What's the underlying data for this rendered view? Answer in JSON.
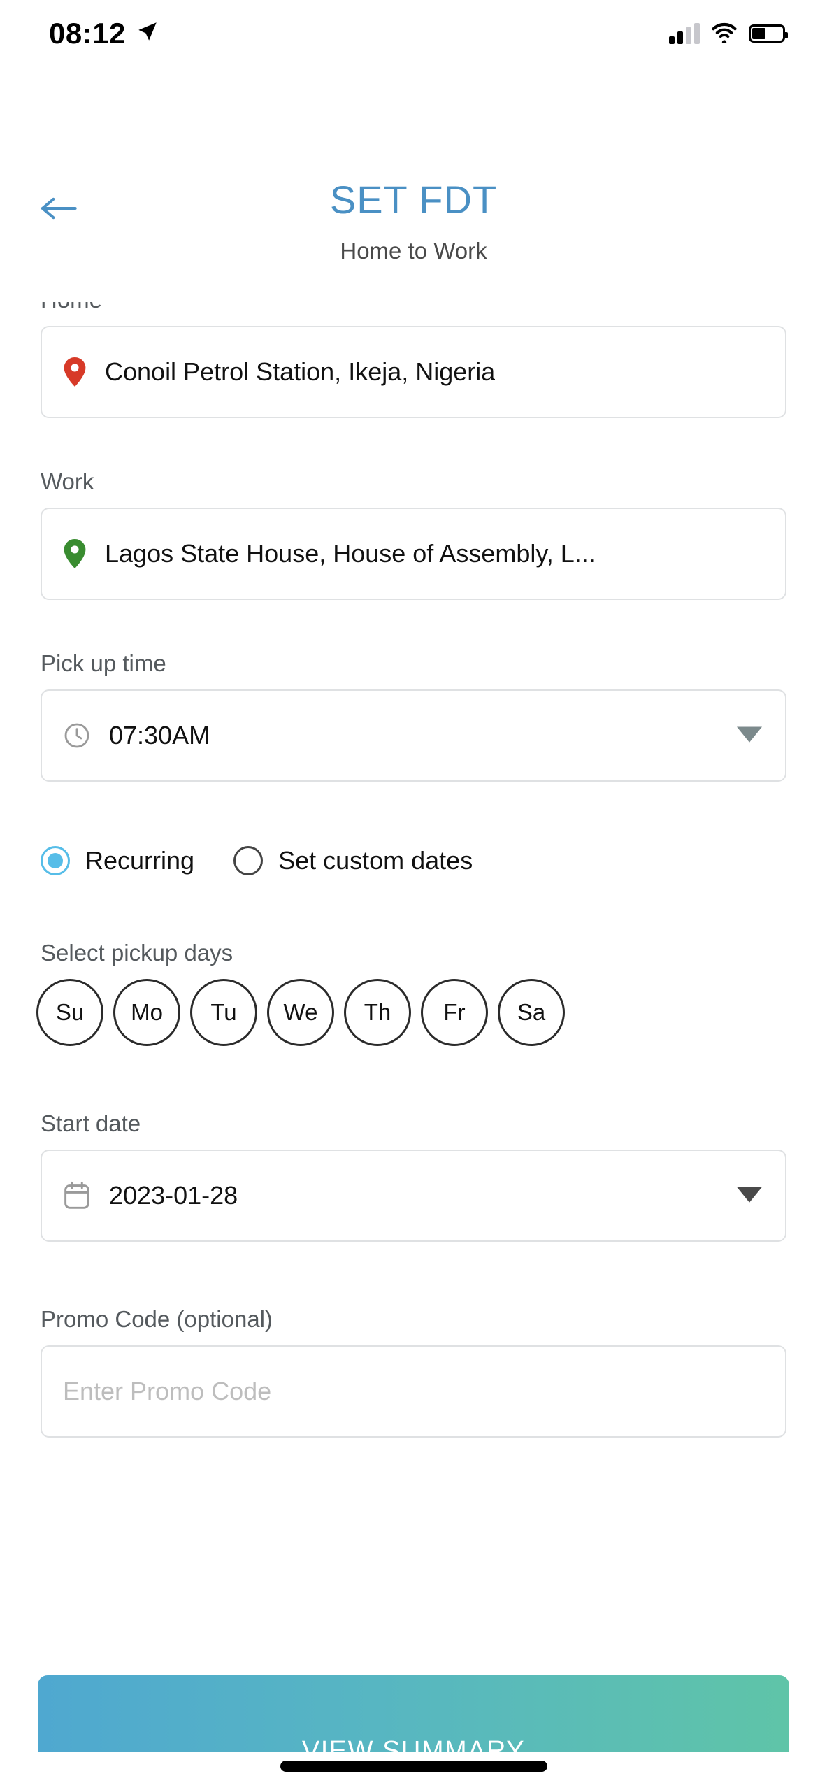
{
  "status_bar": {
    "time": "08:12",
    "location_arrow_icon": "location-arrow-icon",
    "signal_icon": "signal-bars-icon",
    "signal_bars_filled": 2,
    "signal_bars_total": 4,
    "wifi_icon": "wifi-icon",
    "battery_icon": "battery-icon",
    "battery_percent": 45
  },
  "header": {
    "back_icon": "back-arrow-icon",
    "title": "SET FDT",
    "subtitle": "Home to Work",
    "title_color": "#4a90c4"
  },
  "form": {
    "home": {
      "label": "Home",
      "icon": "map-pin-icon",
      "icon_color": "#d73a28",
      "value": "Conoil Petrol Station, Ikeja, Nigeria"
    },
    "work": {
      "label": "Work",
      "icon": "map-pin-icon",
      "icon_color": "#398c30",
      "value": "Lagos State House, House of Assembly, L..."
    },
    "pickup_time": {
      "label": "Pick up time",
      "icon": "clock-icon",
      "value": "07:30AM",
      "caret_icon": "chevron-down-icon",
      "caret_color": "#7c8a8c"
    },
    "schedule_mode": {
      "options": [
        {
          "label": "Recurring",
          "selected": true
        },
        {
          "label": "Set custom dates",
          "selected": false
        }
      ],
      "accent_color": "#56bde8"
    },
    "pickup_days": {
      "label": "Select pickup days",
      "days": [
        {
          "label": "Su",
          "selected": false
        },
        {
          "label": "Mo",
          "selected": false
        },
        {
          "label": "Tu",
          "selected": false
        },
        {
          "label": "We",
          "selected": false
        },
        {
          "label": "Th",
          "selected": false
        },
        {
          "label": "Fr",
          "selected": false
        },
        {
          "label": "Sa",
          "selected": false
        }
      ]
    },
    "start_date": {
      "label": "Start date",
      "icon": "calendar-icon",
      "value": "2023-01-28",
      "caret_icon": "chevron-down-icon",
      "caret_color": "#4a4a4a"
    },
    "promo_code": {
      "label": "Promo Code (optional)",
      "placeholder": "Enter Promo Code",
      "value": ""
    }
  },
  "cta": {
    "label": "VIEW SUMMARY",
    "gradient_from": "#4fa8d0",
    "gradient_to": "#5fc4a8"
  }
}
